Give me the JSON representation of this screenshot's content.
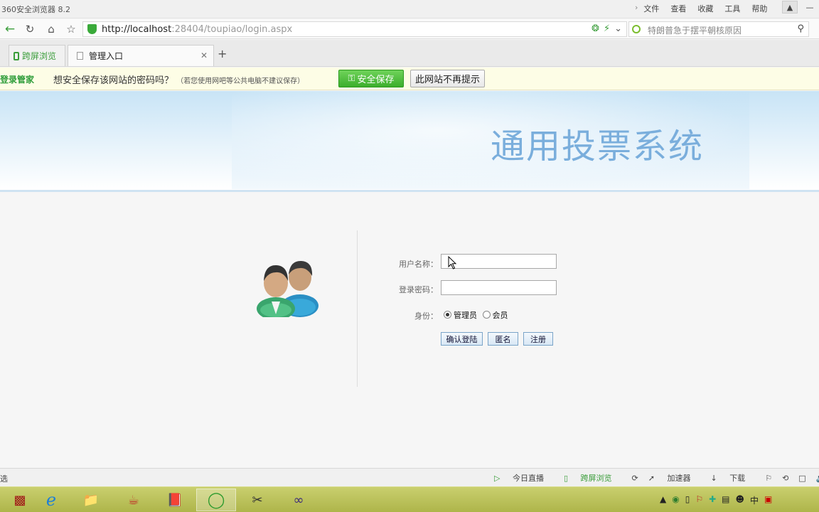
{
  "browser": {
    "title": "360安全浏览器 8.2",
    "menu": [
      "文件",
      "查看",
      "收藏",
      "工具",
      "帮助"
    ],
    "url_host": "http://localhost",
    "url_rest": ":28404/toupiao/login.aspx",
    "search_placeholder": "特朗普急于摆平朝核原因",
    "tabs": [
      {
        "label": "跨屏浏览"
      },
      {
        "label": "管理入口"
      }
    ]
  },
  "password_bar": {
    "brand": "登录管家",
    "question": "想安全保存该网站的密码吗？",
    "note": "（若您使用网吧等公共电脑不建议保存）",
    "save_label": "安全保存",
    "never_label": "此网站不再提示"
  },
  "page": {
    "system_title": "通用投票系统",
    "username_label": "用户名称：",
    "password_label": "登录密码：",
    "role_label": "身份：",
    "role_options": [
      "管理员",
      "会员"
    ],
    "role_selected": "管理员",
    "buttons": {
      "login": "确认登陆",
      "anonymous": "匿名",
      "register": "注册"
    }
  },
  "statusbar": {
    "left": "选",
    "items": [
      "今日直播",
      "跨屏浏览",
      "加速器",
      "下载"
    ]
  },
  "taskbar": {
    "apps": [
      "winrar-icon",
      "ie-icon",
      "explorer-icon",
      "java-icon",
      "book-icon",
      "360-browser-icon",
      "tool-icon",
      "visual-studio-icon"
    ]
  },
  "colors": {
    "accent_green": "#3a9d3a",
    "banner_title": "#7aaedc",
    "taskbar": "#b9c05a"
  }
}
